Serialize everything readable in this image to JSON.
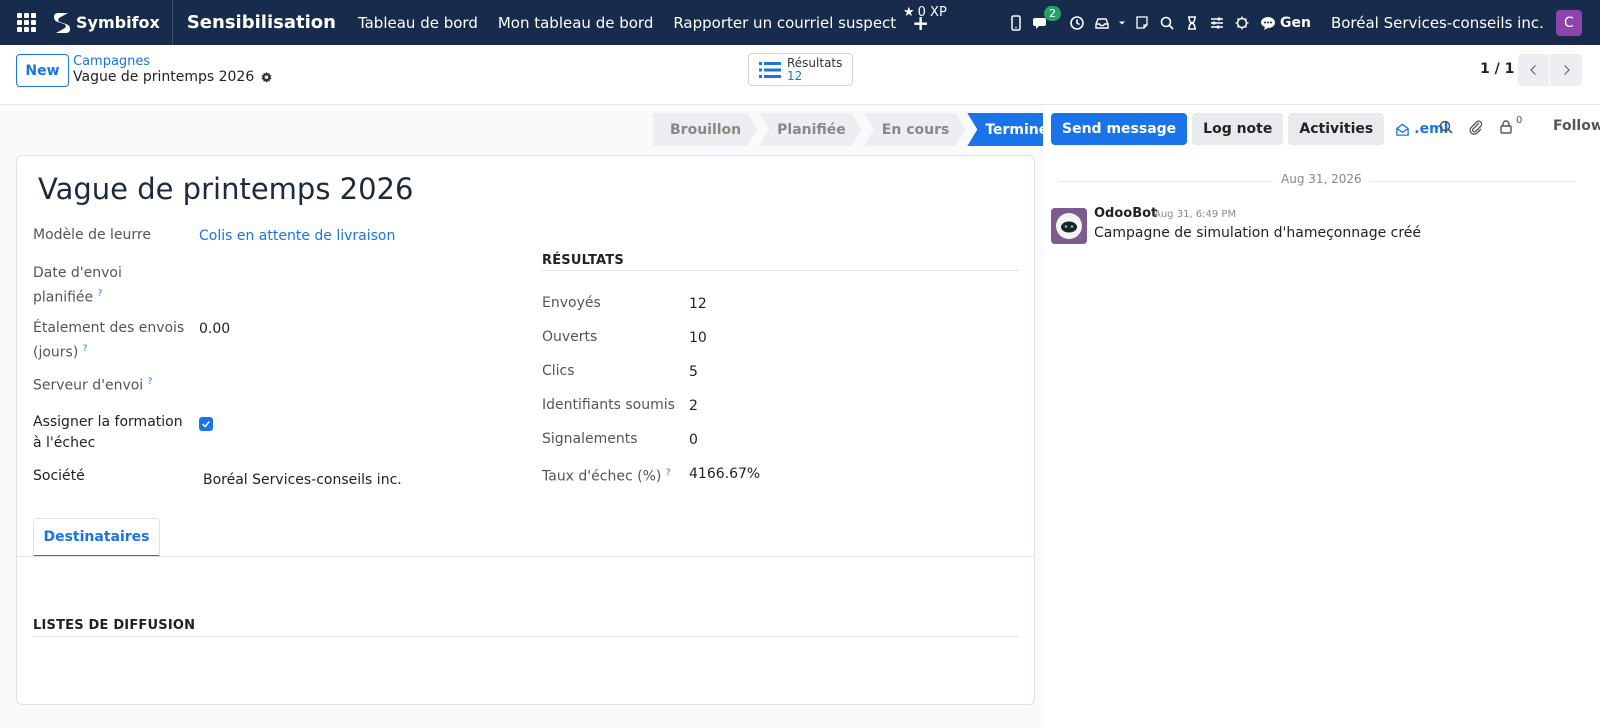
{
  "topbar": {
    "brand": "Symbifox",
    "app_title": "Sensibilisation",
    "menu": [
      "Tableau de bord",
      "Mon tableau de bord",
      "Rapporter un courriel suspect"
    ],
    "xp": "0 XP",
    "messages_count": "2",
    "gen_label": "Gen",
    "company": "Boréal Services-conseils inc.",
    "avatar_letter": "C"
  },
  "control": {
    "new_label": "New",
    "breadcrumb_parent": "Campagnes",
    "breadcrumb_current": "Vague de printemps 2026",
    "smart_label": "Résultats",
    "smart_value": "12",
    "pager": "1 / 1"
  },
  "statusbar": {
    "stages": [
      "Brouillon",
      "Planifiée",
      "En cours",
      "Terminée"
    ],
    "active": "Terminée"
  },
  "form": {
    "title": "Vague de printemps 2026",
    "fields": {
      "lure_label": "Modèle de leurre",
      "lure_value": "Colis en attente de livraison",
      "date_label_1": "Date d'envoi",
      "date_label_2": "planifiée",
      "spread_label_1": "Étalement des envois",
      "spread_label_2": "(jours)",
      "spread_value": "0.00",
      "server_label": "Serveur d'envoi",
      "assign_label_1": "Assigner la formation",
      "assign_label_2": "à l'échec",
      "assign_checked": true,
      "company_label": "Société",
      "company_value": "Boréal Services-conseils inc."
    },
    "results": {
      "section_title": "RÉSULTATS",
      "rows": [
        {
          "label": "Envoyés",
          "value": "12"
        },
        {
          "label": "Ouverts",
          "value": "10"
        },
        {
          "label": "Clics",
          "value": "5"
        },
        {
          "label": "Identifiants soumis",
          "value": "2"
        },
        {
          "label": "Signalements",
          "value": "0"
        },
        {
          "label": "Taux d'échec (%)",
          "value": "4166.67%"
        }
      ]
    },
    "tab_label": "Destinataires",
    "lists_title": "LISTES DE DIFFUSION"
  },
  "chatter": {
    "send_message": "Send message",
    "log_note": "Log note",
    "activities": "Activities",
    "eml": ".eml",
    "followers_count": "0",
    "follow_label": "Follow",
    "date": "Aug 31, 2026",
    "message": {
      "author": "OdooBot",
      "time": "Aug 31, 6:49 PM",
      "body": "Campagne de simulation d'hameçonnage créé"
    }
  },
  "colors": {
    "nav_bg": "#172b4d",
    "accent": "#1a73e8",
    "avatar": "#8e44ad"
  }
}
